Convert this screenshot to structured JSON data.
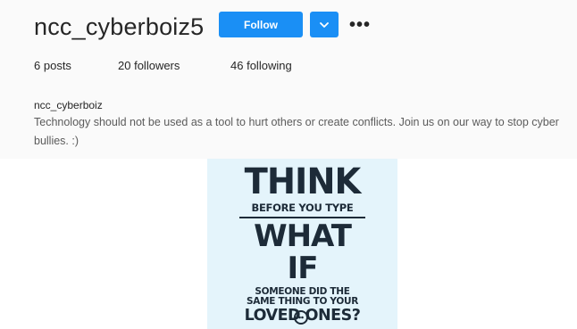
{
  "profile": {
    "username": "ncc_cyberboiz5",
    "follow_label": "Follow",
    "dropdown_icon": "chevron-down-icon",
    "more_icon": "more-options-icon",
    "more_label": "•••",
    "stats": {
      "posts_count": "6",
      "posts_label": "posts",
      "followers_count": "20",
      "followers_label": "followers",
      "following_count": "46",
      "following_label": "following"
    },
    "bio": {
      "name": "ncc_cyberboiz",
      "text": "Technology should not be used as a tool to hurt others or create conflicts. Join us on our way to stop cyber bullies. :)"
    },
    "colors": {
      "follow_blue": "#1a8ff5",
      "poster_bg": "#e4f4fb",
      "poster_text": "#1d2b38"
    }
  },
  "poster": {
    "line1": "THINK",
    "line2": "BEFORE YOU TYPE",
    "line3": "WHAT IF",
    "line4": "SOMEONE DID THE",
    "line5": "SAME THING TO YOUR",
    "line6": "LOVED ONES?",
    "logo_icon": "ncc-logo-icon"
  }
}
